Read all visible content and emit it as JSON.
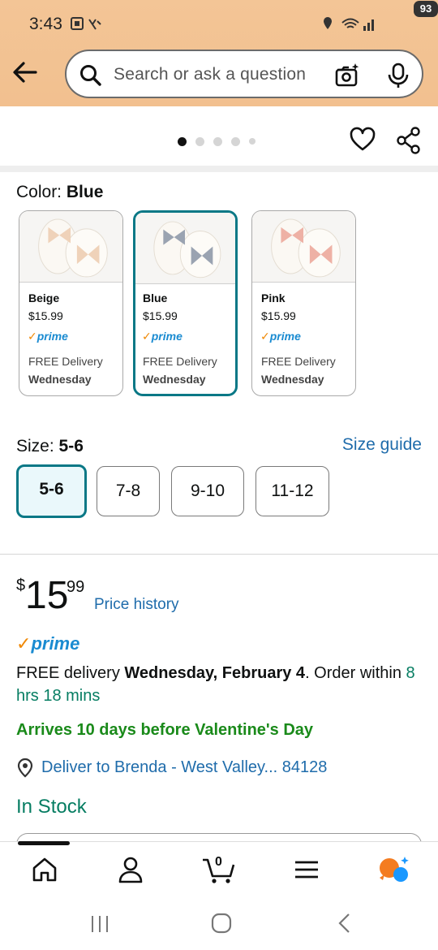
{
  "status_bar": {
    "time": "3:43",
    "battery": "93"
  },
  "search": {
    "placeholder": "Search or ask a question"
  },
  "carousel": {
    "dot_count": 5,
    "active_index": 0
  },
  "color": {
    "label": "Color:",
    "selected": "Blue",
    "options": [
      {
        "name": "Beige",
        "price": "$15.99",
        "prime": "prime",
        "delivery": "FREE Delivery",
        "day": "Wednesday",
        "bow_color": "#efd2b9"
      },
      {
        "name": "Blue",
        "price": "$15.99",
        "prime": "prime",
        "delivery": "FREE Delivery",
        "day": "Wednesday",
        "bow_color": "#9aa3b1"
      },
      {
        "name": "Pink",
        "price": "$15.99",
        "prime": "prime",
        "delivery": "FREE Delivery",
        "day": "Wednesday",
        "bow_color": "#eeb1a5"
      }
    ]
  },
  "size": {
    "label": "Size:",
    "selected": "5-6",
    "guide_link": "Size guide",
    "options": [
      "5-6",
      "7-8",
      "9-10",
      "11-12"
    ]
  },
  "price": {
    "symbol": "$",
    "whole": "15",
    "fraction": "99",
    "history_link": "Price history"
  },
  "prime_badge": "prime",
  "delivery": {
    "prefix": "FREE delivery ",
    "date": "Wednesday, February 4",
    "order_within": ". Order within ",
    "countdown": "8 hrs 18 mins"
  },
  "promo": "Arrives 10 days before Valentine's Day",
  "deliver_to": "Deliver to Brenda - West Valley... 84128",
  "stock": "In Stock",
  "bottom_nav": {
    "cart_count": "0",
    "items": [
      "home-icon",
      "account-icon",
      "cart-icon",
      "menu-icon",
      "rufus-icon"
    ]
  },
  "colors": {
    "teal": "#0a7886",
    "link": "#1f6cab",
    "green": "#067d62",
    "prime_blue": "#1a8bd1",
    "orange": "#f08804"
  }
}
